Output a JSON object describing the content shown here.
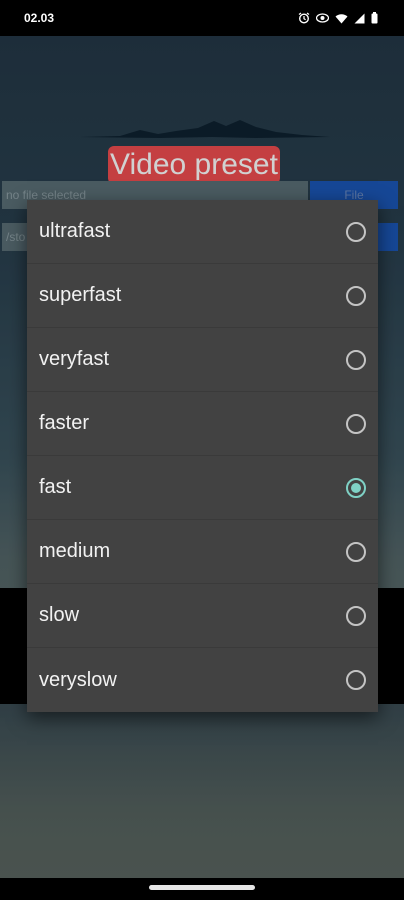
{
  "status_bar": {
    "time": "02.03",
    "icons": [
      "alarm-icon",
      "data-saver-icon",
      "wifi-icon",
      "signal-icon",
      "battery-icon"
    ]
  },
  "app": {
    "title": "Video preset",
    "file_field_placeholder": "no file selected",
    "file_button_label": "File",
    "path_field_value": "/sto"
  },
  "dialog": {
    "options": [
      {
        "label": "ultrafast",
        "selected": false
      },
      {
        "label": "superfast",
        "selected": false
      },
      {
        "label": "veryfast",
        "selected": false
      },
      {
        "label": "faster",
        "selected": false
      },
      {
        "label": "fast",
        "selected": true
      },
      {
        "label": "medium",
        "selected": false
      },
      {
        "label": "slow",
        "selected": false
      },
      {
        "label": "veryslow",
        "selected": false
      }
    ]
  },
  "colors": {
    "accent": "#7fd1c5",
    "title_badge": "#ef4d50",
    "dialog_bg": "#424242",
    "button_blue": "#1b57b8"
  }
}
